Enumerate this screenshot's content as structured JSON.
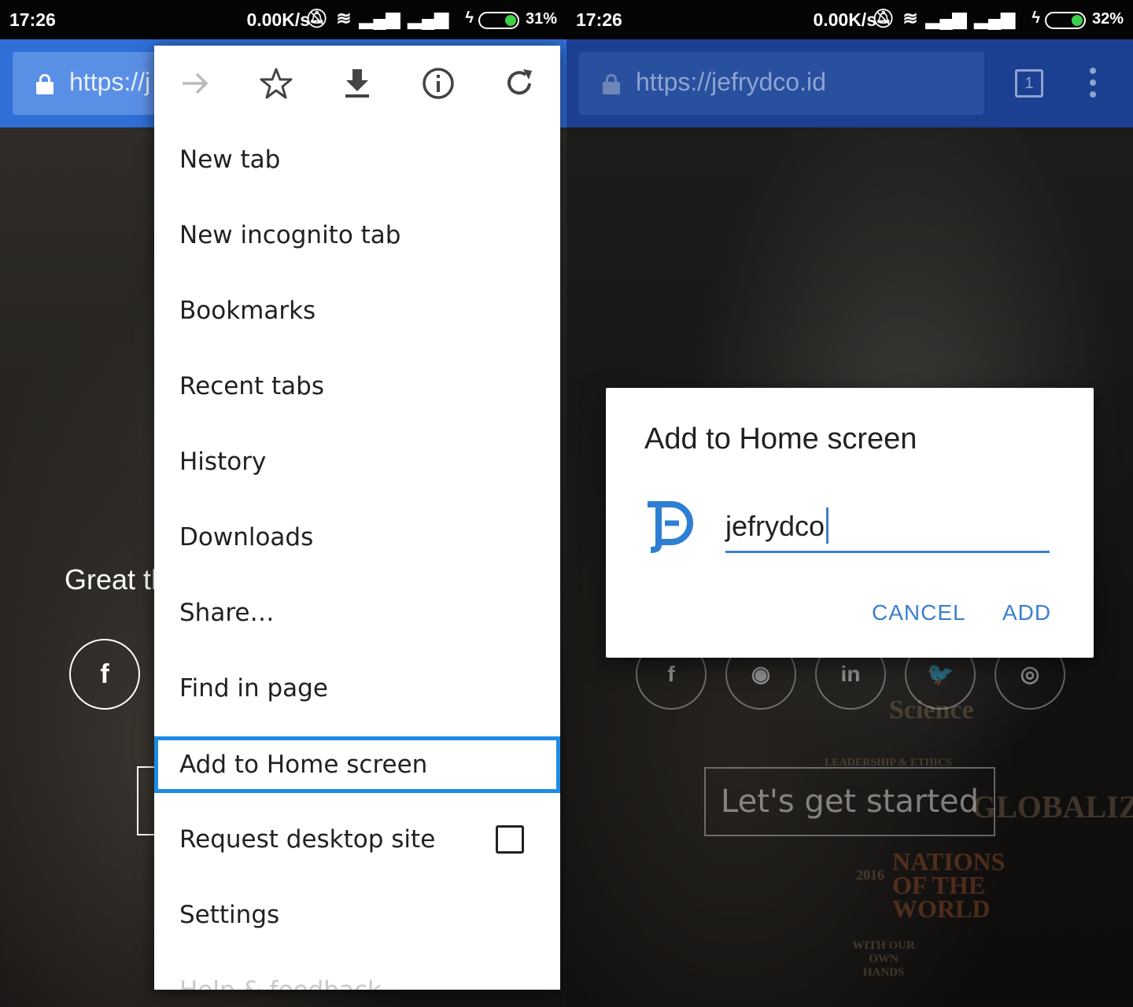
{
  "left": {
    "status": {
      "time": "17:26",
      "speed": "0.00K/s",
      "battery_pct": "31%",
      "battery_level": 0.31
    },
    "url": "https://j",
    "hero_text": "Great th",
    "social_glyph": "f",
    "menu": {
      "icons": [
        "forward-icon",
        "star-icon",
        "download-icon",
        "info-icon",
        "reload-icon"
      ],
      "items": [
        {
          "label": "New tab"
        },
        {
          "label": "New incognito tab"
        },
        {
          "label": "Bookmarks"
        },
        {
          "label": "Recent tabs"
        },
        {
          "label": "History"
        },
        {
          "label": "Downloads"
        },
        {
          "label": "Share…"
        },
        {
          "label": "Find in page"
        },
        {
          "label": "Add to Home screen",
          "highlighted": true
        },
        {
          "label": "Request desktop site",
          "checkbox": false
        },
        {
          "label": "Settings"
        },
        {
          "label": "Help & feedback"
        }
      ]
    }
  },
  "right": {
    "status": {
      "time": "17:26",
      "speed": "0.00K/s",
      "battery_pct": "32%",
      "battery_level": 0.32
    },
    "url": "https://jefrydco.id",
    "tab_count": "1",
    "social_icons": [
      "facebook-icon",
      "github-icon",
      "linkedin-icon",
      "twitter-icon",
      "instagram-icon"
    ],
    "social_glyphs": [
      "f",
      "◉",
      "in",
      "🐦",
      "◎"
    ],
    "cta": "Let's get started",
    "dialog": {
      "title": "Add to Home screen",
      "name_value": "jefrydco",
      "cancel": "CANCEL",
      "add": "ADD"
    },
    "background_books": [
      "Science",
      "LEADERSHIP & ETHICS",
      "GLOBALIZATION",
      "NATIONS OF THE WORLD",
      "2016",
      "WITH OUR OWN HANDS"
    ]
  },
  "colors": {
    "toolbar_active": "#2f6fd6",
    "toolbar_dimmed": "#1b4092",
    "menu_highlight": "#1d8be4",
    "dialog_accent": "#3b80cf",
    "battery_green": "#3fd04b"
  }
}
